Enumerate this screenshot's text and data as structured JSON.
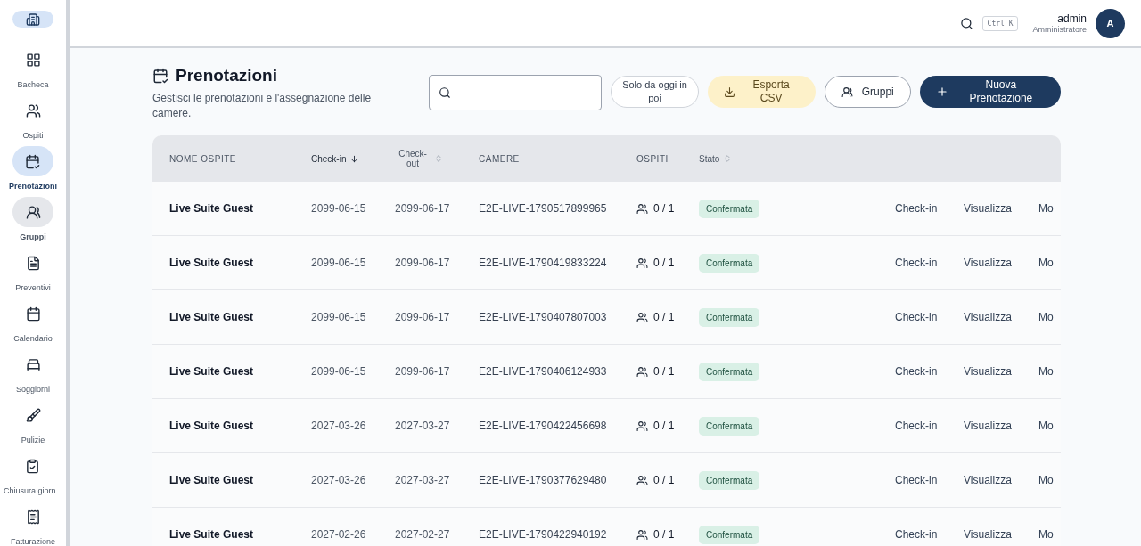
{
  "sidebar": {
    "items": [
      {
        "label": "Bacheca",
        "selected": false,
        "highlighted": false
      },
      {
        "label": "Ospiti",
        "selected": false,
        "highlighted": false
      },
      {
        "label": "Prenotazioni",
        "selected": true,
        "highlighted": false
      },
      {
        "label": "Gruppi",
        "selected": false,
        "highlighted": true
      },
      {
        "label": "Preventivi",
        "selected": false,
        "highlighted": false
      },
      {
        "label": "Calendario",
        "selected": false,
        "highlighted": false
      },
      {
        "label": "Soggiorni",
        "selected": false,
        "highlighted": false
      },
      {
        "label": "Pulizie",
        "selected": false,
        "highlighted": false
      },
      {
        "label": "Chiusura giorn...",
        "selected": false,
        "highlighted": false
      },
      {
        "label": "Fatturazione",
        "selected": false,
        "highlighted": false
      }
    ]
  },
  "topbar": {
    "shortcut": "Ctrl K",
    "user": {
      "name": "admin",
      "role": "Amministratore",
      "initial": "A"
    }
  },
  "page": {
    "title": "Prenotazioni",
    "subtitle": "Gestisci le prenotazioni e l'assegnazione delle camere.",
    "filter_button": "Solo da oggi in poi",
    "export_button": "Esporta CSV",
    "groups_button": "Gruppi",
    "new_button": "Nuova Prenotazione"
  },
  "table": {
    "columns": [
      {
        "label": "NOME OSPITE",
        "sortable": false,
        "sorted": false
      },
      {
        "label": "Check-in",
        "sortable": true,
        "sorted": true
      },
      {
        "label": "Check-out",
        "sortable": true,
        "sorted": false
      },
      {
        "label": "CAMERE",
        "sortable": false,
        "sorted": false
      },
      {
        "label": "OSPITI",
        "sortable": false,
        "sorted": false
      },
      {
        "label": "Stato",
        "sortable": true,
        "sorted": false
      }
    ],
    "rows": [
      {
        "guest": "Live Suite Guest",
        "check_in": "2099-06-15",
        "check_out": "2099-06-17",
        "room": "E2E-LIVE-1790517899965",
        "guests": "0 / 1",
        "status": "Confermata",
        "actions": [
          "Check-in",
          "Visualizza",
          "Mo"
        ]
      },
      {
        "guest": "Live Suite Guest",
        "check_in": "2099-06-15",
        "check_out": "2099-06-17",
        "room": "E2E-LIVE-1790419833224",
        "guests": "0 / 1",
        "status": "Confermata",
        "actions": [
          "Check-in",
          "Visualizza",
          "Mo"
        ]
      },
      {
        "guest": "Live Suite Guest",
        "check_in": "2099-06-15",
        "check_out": "2099-06-17",
        "room": "E2E-LIVE-1790407807003",
        "guests": "0 / 1",
        "status": "Confermata",
        "actions": [
          "Check-in",
          "Visualizza",
          "Mo"
        ]
      },
      {
        "guest": "Live Suite Guest",
        "check_in": "2099-06-15",
        "check_out": "2099-06-17",
        "room": "E2E-LIVE-1790406124933",
        "guests": "0 / 1",
        "status": "Confermata",
        "actions": [
          "Check-in",
          "Visualizza",
          "Mo"
        ]
      },
      {
        "guest": "Live Suite Guest",
        "check_in": "2027-03-26",
        "check_out": "2027-03-27",
        "room": "E2E-LIVE-1790422456698",
        "guests": "0 / 1",
        "status": "Confermata",
        "actions": [
          "Check-in",
          "Visualizza",
          "Mo"
        ]
      },
      {
        "guest": "Live Suite Guest",
        "check_in": "2027-03-26",
        "check_out": "2027-03-27",
        "room": "E2E-LIVE-1790377629480",
        "guests": "0 / 1",
        "status": "Confermata",
        "actions": [
          "Check-in",
          "Visualizza",
          "Mo"
        ]
      },
      {
        "guest": "Live Suite Guest",
        "check_in": "2027-02-26",
        "check_out": "2027-02-27",
        "room": "E2E-LIVE-1790422940192",
        "guests": "0 / 1",
        "status": "Confermata",
        "actions": [
          "Check-in",
          "Visualizza",
          "Mo"
        ]
      }
    ]
  }
}
